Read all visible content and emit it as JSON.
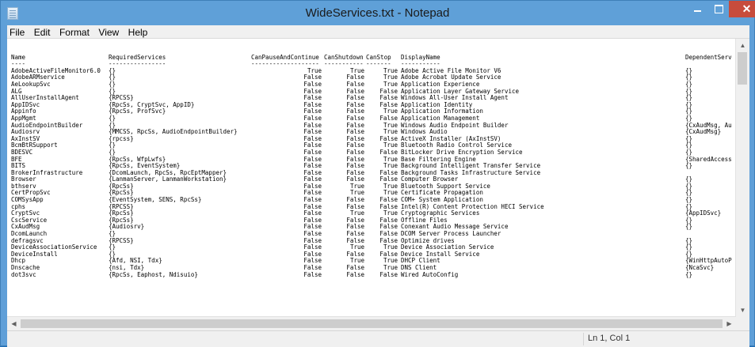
{
  "window": {
    "title": "WideServices.txt - Notepad"
  },
  "menubar": {
    "items": [
      "File",
      "Edit",
      "Format",
      "View",
      "Help"
    ]
  },
  "columns": [
    "Name",
    "RequiredServices",
    "CanPauseAndContinue",
    "CanShutdown",
    "CanStop",
    "DisplayName",
    "DependentServic"
  ],
  "column_underlines": [
    "----",
    "----------------",
    "-------------------",
    "-----------",
    "-------",
    "-----------",
    ""
  ],
  "rows": [
    [
      "AdobeActiveFileMonitor6.0",
      "{}",
      "True",
      "True",
      "True",
      "Adobe Active File Monitor V6",
      "{}"
    ],
    [
      "AdobeARMservice",
      "{}",
      "False",
      "False",
      "True",
      "Adobe Acrobat Update Service",
      "{}"
    ],
    [
      "AeLookupSvc",
      "{}",
      "False",
      "False",
      "True",
      "Application Experience",
      "{}"
    ],
    [
      "ALG",
      "{}",
      "False",
      "False",
      "False",
      "Application Layer Gateway Service",
      "{}"
    ],
    [
      "AllUserInstallAgent",
      "{RPCSS}",
      "False",
      "False",
      "False",
      "Windows All-User Install Agent",
      "{}"
    ],
    [
      "AppIDSvc",
      "{RpcSs, CryptSvc, AppID}",
      "False",
      "False",
      "False",
      "Application Identity",
      "{}"
    ],
    [
      "Appinfo",
      "{RpcSs, ProfSvc}",
      "False",
      "False",
      "True",
      "Application Information",
      "{}"
    ],
    [
      "AppMgmt",
      "{}",
      "False",
      "False",
      "False",
      "Application Management",
      "{}"
    ],
    [
      "AudioEndpointBuilder",
      "{}",
      "False",
      "False",
      "True",
      "Windows Audio Endpoint Builder",
      "{CxAudMsg, Audi"
    ],
    [
      "Audiosrv",
      "{MMCSS, RpcSs, AudioEndpointBuilder}",
      "False",
      "False",
      "True",
      "Windows Audio",
      "{CxAudMsg}"
    ],
    [
      "AxInstSV",
      "{rpcss}",
      "False",
      "False",
      "False",
      "ActiveX Installer (AxInstSV)",
      "{}"
    ],
    [
      "BcmBtRSupport",
      "{}",
      "False",
      "False",
      "True",
      "Bluetooth Radio Control Service",
      "{}"
    ],
    [
      "BDESVC",
      "{}",
      "False",
      "False",
      "False",
      "BitLocker Drive Encryption Service",
      "{}"
    ],
    [
      "BFE",
      "{RpcSs, WfpLwfs}",
      "False",
      "False",
      "True",
      "Base Filtering Engine",
      "{SharedAccess,"
    ],
    [
      "BITS",
      "{RpcSs, EventSystem}",
      "False",
      "False",
      "True",
      "Background Intelligent Transfer Service",
      "{}"
    ],
    [
      "BrokerInfrastructure",
      "{DcomLaunch, RpcSs, RpcEptMapper}",
      "False",
      "False",
      "False",
      "Background Tasks Infrastructure Service",
      ""
    ],
    [
      "Browser",
      "{LanmanServer, LanmanWorkstation}",
      "False",
      "False",
      "False",
      "Computer Browser",
      "{}"
    ],
    [
      "bthserv",
      "{RpcSs}",
      "False",
      "True",
      "True",
      "Bluetooth Support Service",
      "{}"
    ],
    [
      "CertPropSvc",
      "{RpcSs}",
      "False",
      "True",
      "True",
      "Certificate Propagation",
      "{}"
    ],
    [
      "COMSysApp",
      "{EventSystem, SENS, RpcSs}",
      "False",
      "False",
      "False",
      "COM+ System Application",
      "{}"
    ],
    [
      "cphs",
      "{RPCSS}",
      "False",
      "False",
      "False",
      "Intel(R) Content Protection HECI Service",
      "{}"
    ],
    [
      "CryptSvc",
      "{RpcSs}",
      "False",
      "True",
      "True",
      "Cryptographic Services",
      "{AppIDSvc}"
    ],
    [
      "CscService",
      "{RpcSs}",
      "False",
      "False",
      "False",
      "Offline Files",
      "{}"
    ],
    [
      "CxAudMsg",
      "{Audiosrv}",
      "False",
      "False",
      "False",
      "Conexant Audio Message Service",
      "{}"
    ],
    [
      "DcomLaunch",
      "{}",
      "False",
      "False",
      "False",
      "DCOM Server Process Launcher",
      ""
    ],
    [
      "defragsvc",
      "{RPCSS}",
      "False",
      "False",
      "False",
      "Optimize drives",
      "{}"
    ],
    [
      "DeviceAssociationService",
      "{}",
      "False",
      "True",
      "True",
      "Device Association Service",
      "{}"
    ],
    [
      "DeviceInstall",
      "{}",
      "False",
      "False",
      "False",
      "Device Install Service",
      "{}"
    ],
    [
      "Dhcp",
      "{Afd, NSI, Tdx}",
      "False",
      "True",
      "True",
      "DHCP Client",
      "{WinHttpAutoPro"
    ],
    [
      "Dnscache",
      "{nsi, Tdx}",
      "False",
      "False",
      "True",
      "DNS Client",
      "{NcaSvc}"
    ],
    [
      "dot3svc",
      "{RpcSs, Eaphost, Ndisuio}",
      "False",
      "False",
      "False",
      "Wired AutoConfig",
      "{}"
    ]
  ],
  "statusbar": {
    "position": "Ln 1, Col 1"
  }
}
